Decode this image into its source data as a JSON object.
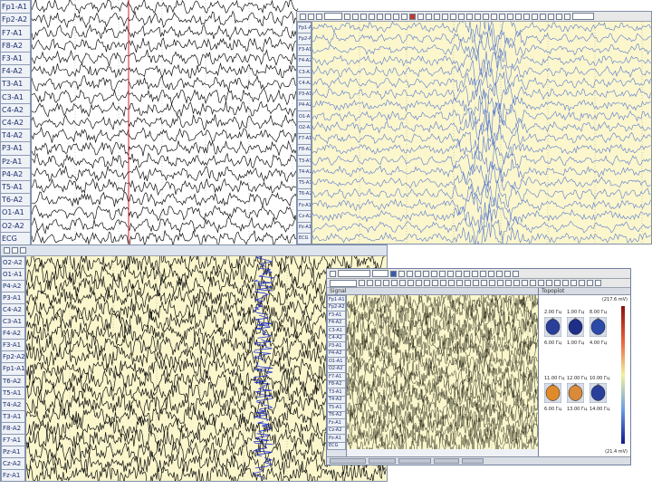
{
  "panel_a": {
    "name": "eeg-panel-top-left",
    "bg": "#ffffff",
    "trace_color": "#111111",
    "cursor_color": "#d0202a",
    "label_font_px": 8,
    "channels": [
      "Fp1-A1",
      "Fp2-A2",
      "F7-A1",
      "F8-A2",
      "F3-A1",
      "F4-A2",
      "T3-A1",
      "C3-A1",
      "C4-A2",
      "C4-A2",
      "T4-A2",
      "P3-A1",
      "Pz-A1",
      "P4-A2",
      "T5-A1",
      "T6-A2",
      "O1-A1",
      "O2-A2",
      "ECG"
    ]
  },
  "panel_b": {
    "name": "eeg-panel-top-right",
    "bg": "#fbf6cc",
    "trace_color": "#5a7ad0",
    "label_font_px": 5,
    "toolbar_field": "",
    "channels": [
      "Fp1-A1",
      "Fp2-A2",
      "F3-A1",
      "F4-A2",
      "C3-A1",
      "C4-A2",
      "P3-A1",
      "P4-A2",
      "O1-A1",
      "O2-A2",
      "F7-A1",
      "F8-A2",
      "T3-A1",
      "T4-A2",
      "T5-A1",
      "T6-A2",
      "Fz-A1",
      "Cz-A2",
      "Pz-A1",
      "ECG"
    ]
  },
  "panel_c": {
    "name": "eeg-panel-bottom-left",
    "bg": "#fbf6cc",
    "trace_color": "#111111",
    "spike_color": "#2233cc",
    "label_font_px": 7,
    "channels": [
      "O2-A2",
      "O1-A1",
      "P4-A2",
      "P3-A1",
      "C4-A2",
      "C3-A1",
      "F4-A2",
      "F3-A1",
      "Fp2-A2",
      "Fp1-A1",
      "T6-A2",
      "T5-A1",
      "T4-A2",
      "T3-A1",
      "F8-A2",
      "F7-A1",
      "Pz-A1",
      "Cz-A2",
      "Fz-A1"
    ]
  },
  "panel_d": {
    "name": "eeg-panel-bottom-right",
    "bg": "#fbf6cc",
    "trace_color": "#333322",
    "label_font_px": 5,
    "title_left": "Signal",
    "title_right": "Topoplot",
    "scale_top": "(217.6 mV)",
    "scale_bottom": "(21.4 mV)",
    "channels": [
      "Fp1-A1",
      "Fp2-A2",
      "F3-A1",
      "F4-A2",
      "C3-A1",
      "C4-A2",
      "P3-A1",
      "P4-A2",
      "O1-A1",
      "O2-A2",
      "F7-A1",
      "F8-A2",
      "T3-A1",
      "T4-A2",
      "T5-A1",
      "T6-A2",
      "Fz-A1",
      "Cz-A2",
      "Pz-A1",
      "ECG"
    ],
    "topo_labels": {
      "row1": [
        "2.00 Гц",
        "1.00 Гц",
        "8.00 Гц"
      ],
      "row2": [
        "6.00 Гц",
        "1.00 Гц",
        "4.00 Гц"
      ],
      "row3": [
        "11.00 Гц",
        "12.00 Гц",
        "10.00 Гц"
      ],
      "row4": [
        "6.00 Гц",
        "13.00 Гц",
        "14.00 Гц"
      ]
    },
    "colorbar_top": "#8a1010",
    "colorbar_mid": "#f0f0a0",
    "colorbar_bottom": "#101a8a"
  }
}
